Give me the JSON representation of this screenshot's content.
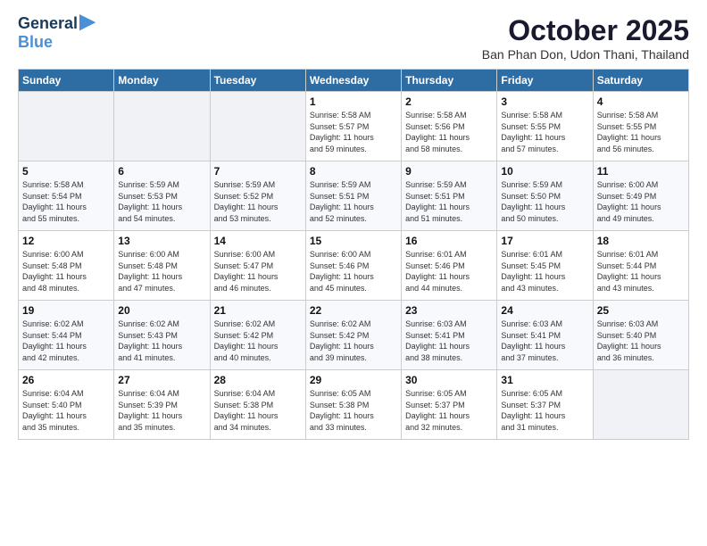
{
  "logo": {
    "line1": "General",
    "line2": "Blue"
  },
  "title": "October 2025",
  "subtitle": "Ban Phan Don, Udon Thani, Thailand",
  "weekdays": [
    "Sunday",
    "Monday",
    "Tuesday",
    "Wednesday",
    "Thursday",
    "Friday",
    "Saturday"
  ],
  "weeks": [
    [
      {
        "day": "",
        "info": ""
      },
      {
        "day": "",
        "info": ""
      },
      {
        "day": "",
        "info": ""
      },
      {
        "day": "1",
        "info": "Sunrise: 5:58 AM\nSunset: 5:57 PM\nDaylight: 11 hours\nand 59 minutes."
      },
      {
        "day": "2",
        "info": "Sunrise: 5:58 AM\nSunset: 5:56 PM\nDaylight: 11 hours\nand 58 minutes."
      },
      {
        "day": "3",
        "info": "Sunrise: 5:58 AM\nSunset: 5:55 PM\nDaylight: 11 hours\nand 57 minutes."
      },
      {
        "day": "4",
        "info": "Sunrise: 5:58 AM\nSunset: 5:55 PM\nDaylight: 11 hours\nand 56 minutes."
      }
    ],
    [
      {
        "day": "5",
        "info": "Sunrise: 5:58 AM\nSunset: 5:54 PM\nDaylight: 11 hours\nand 55 minutes."
      },
      {
        "day": "6",
        "info": "Sunrise: 5:59 AM\nSunset: 5:53 PM\nDaylight: 11 hours\nand 54 minutes."
      },
      {
        "day": "7",
        "info": "Sunrise: 5:59 AM\nSunset: 5:52 PM\nDaylight: 11 hours\nand 53 minutes."
      },
      {
        "day": "8",
        "info": "Sunrise: 5:59 AM\nSunset: 5:51 PM\nDaylight: 11 hours\nand 52 minutes."
      },
      {
        "day": "9",
        "info": "Sunrise: 5:59 AM\nSunset: 5:51 PM\nDaylight: 11 hours\nand 51 minutes."
      },
      {
        "day": "10",
        "info": "Sunrise: 5:59 AM\nSunset: 5:50 PM\nDaylight: 11 hours\nand 50 minutes."
      },
      {
        "day": "11",
        "info": "Sunrise: 6:00 AM\nSunset: 5:49 PM\nDaylight: 11 hours\nand 49 minutes."
      }
    ],
    [
      {
        "day": "12",
        "info": "Sunrise: 6:00 AM\nSunset: 5:48 PM\nDaylight: 11 hours\nand 48 minutes."
      },
      {
        "day": "13",
        "info": "Sunrise: 6:00 AM\nSunset: 5:48 PM\nDaylight: 11 hours\nand 47 minutes."
      },
      {
        "day": "14",
        "info": "Sunrise: 6:00 AM\nSunset: 5:47 PM\nDaylight: 11 hours\nand 46 minutes."
      },
      {
        "day": "15",
        "info": "Sunrise: 6:00 AM\nSunset: 5:46 PM\nDaylight: 11 hours\nand 45 minutes."
      },
      {
        "day": "16",
        "info": "Sunrise: 6:01 AM\nSunset: 5:46 PM\nDaylight: 11 hours\nand 44 minutes."
      },
      {
        "day": "17",
        "info": "Sunrise: 6:01 AM\nSunset: 5:45 PM\nDaylight: 11 hours\nand 43 minutes."
      },
      {
        "day": "18",
        "info": "Sunrise: 6:01 AM\nSunset: 5:44 PM\nDaylight: 11 hours\nand 43 minutes."
      }
    ],
    [
      {
        "day": "19",
        "info": "Sunrise: 6:02 AM\nSunset: 5:44 PM\nDaylight: 11 hours\nand 42 minutes."
      },
      {
        "day": "20",
        "info": "Sunrise: 6:02 AM\nSunset: 5:43 PM\nDaylight: 11 hours\nand 41 minutes."
      },
      {
        "day": "21",
        "info": "Sunrise: 6:02 AM\nSunset: 5:42 PM\nDaylight: 11 hours\nand 40 minutes."
      },
      {
        "day": "22",
        "info": "Sunrise: 6:02 AM\nSunset: 5:42 PM\nDaylight: 11 hours\nand 39 minutes."
      },
      {
        "day": "23",
        "info": "Sunrise: 6:03 AM\nSunset: 5:41 PM\nDaylight: 11 hours\nand 38 minutes."
      },
      {
        "day": "24",
        "info": "Sunrise: 6:03 AM\nSunset: 5:41 PM\nDaylight: 11 hours\nand 37 minutes."
      },
      {
        "day": "25",
        "info": "Sunrise: 6:03 AM\nSunset: 5:40 PM\nDaylight: 11 hours\nand 36 minutes."
      }
    ],
    [
      {
        "day": "26",
        "info": "Sunrise: 6:04 AM\nSunset: 5:40 PM\nDaylight: 11 hours\nand 35 minutes."
      },
      {
        "day": "27",
        "info": "Sunrise: 6:04 AM\nSunset: 5:39 PM\nDaylight: 11 hours\nand 35 minutes."
      },
      {
        "day": "28",
        "info": "Sunrise: 6:04 AM\nSunset: 5:38 PM\nDaylight: 11 hours\nand 34 minutes."
      },
      {
        "day": "29",
        "info": "Sunrise: 6:05 AM\nSunset: 5:38 PM\nDaylight: 11 hours\nand 33 minutes."
      },
      {
        "day": "30",
        "info": "Sunrise: 6:05 AM\nSunset: 5:37 PM\nDaylight: 11 hours\nand 32 minutes."
      },
      {
        "day": "31",
        "info": "Sunrise: 6:05 AM\nSunset: 5:37 PM\nDaylight: 11 hours\nand 31 minutes."
      },
      {
        "day": "",
        "info": ""
      }
    ]
  ]
}
